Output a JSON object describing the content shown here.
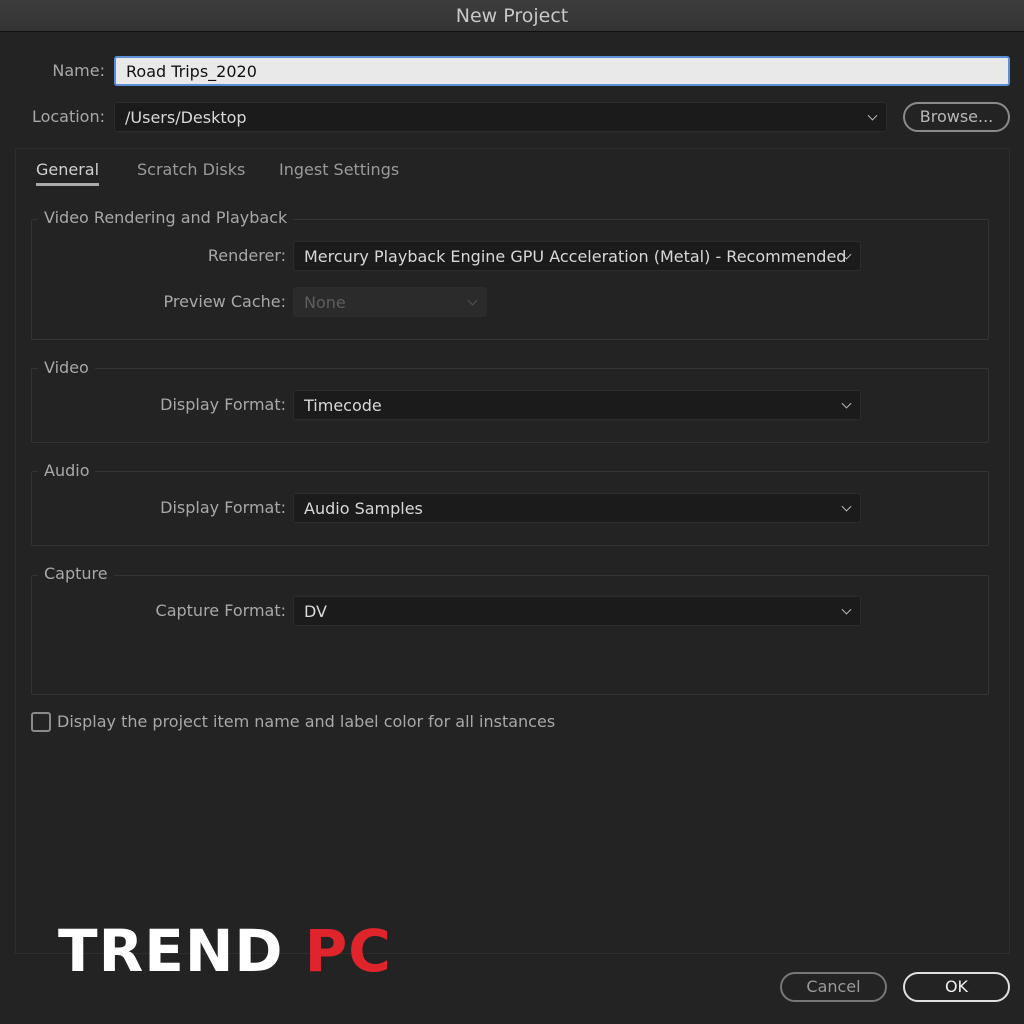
{
  "window": {
    "title": "New Project"
  },
  "name": {
    "label": "Name:",
    "value": "Road Trips_2020"
  },
  "location": {
    "label": "Location:",
    "value": "/Users/Desktop",
    "browse_label": "Browse..."
  },
  "tabs": [
    {
      "label": "General",
      "active": true
    },
    {
      "label": "Scratch Disks"
    },
    {
      "label": "Ingest Settings"
    }
  ],
  "groups": {
    "rendering": {
      "title": "Video Rendering and Playback",
      "renderer_label": "Renderer:",
      "renderer_value": "Mercury Playback Engine GPU Acceleration (Metal) - Recommended",
      "cache_label": "Preview Cache:",
      "cache_value": "None"
    },
    "video": {
      "title": "Video",
      "label": "Display Format:",
      "value": "Timecode"
    },
    "audio": {
      "title": "Audio",
      "label": "Display Format:",
      "value": "Audio Samples"
    },
    "capture": {
      "title": "Capture",
      "label": "Capture Format:",
      "value": "DV"
    }
  },
  "checkbox": {
    "label": "Display the project item name and label color for all instances",
    "checked": false
  },
  "watermark": {
    "text": "TREND PC",
    "accent": "#e0242c"
  },
  "buttons": {
    "cancel": "Cancel",
    "ok": "OK"
  }
}
